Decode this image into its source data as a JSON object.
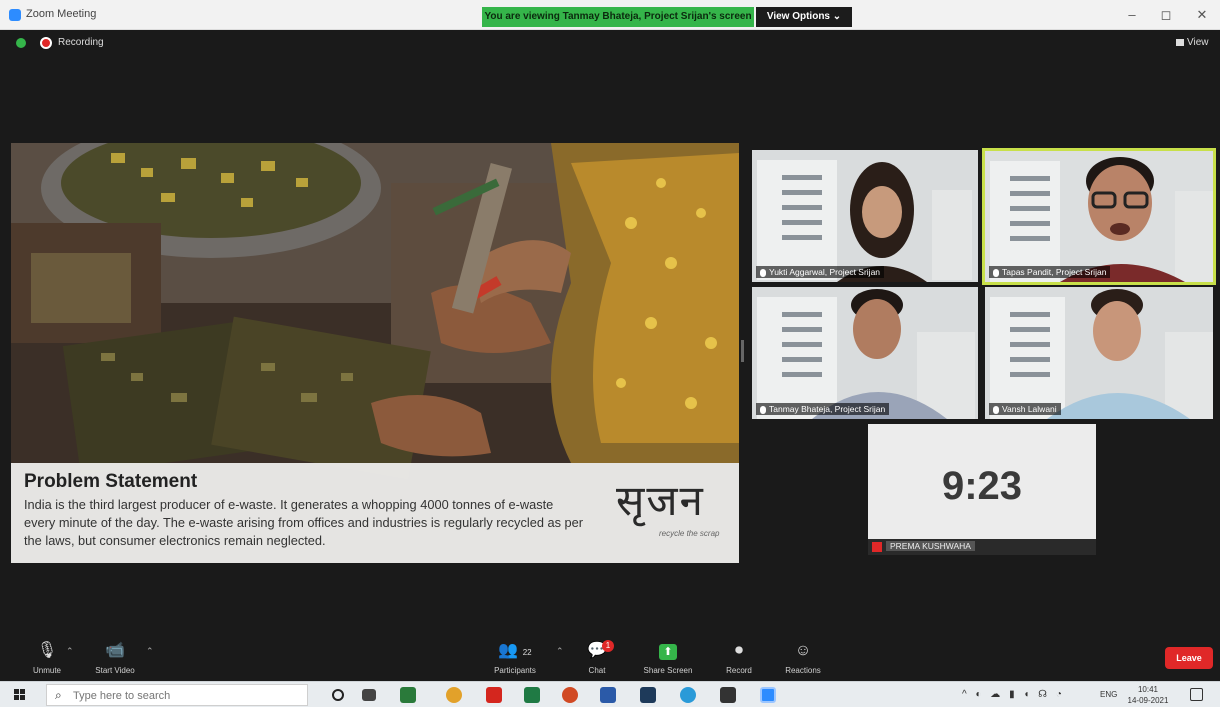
{
  "window": {
    "title": "Zoom Meeting",
    "share_banner": "You are viewing Tanmay Bhateja, Project Srijan's screen",
    "view_options": "View Options ⌄",
    "controls": [
      "–",
      "◻",
      "✕"
    ]
  },
  "meeting_bar": {
    "recording_label": "Recording",
    "view_label": "View"
  },
  "slide": {
    "title": "Problem Statement",
    "body": "India is the third largest producer of e-waste. It generates a whopping 4000 tonnes of e-waste every minute of the day. The e-waste arising from offices and industries is regularly recycled as per the laws, but consumer electronics remain neglected.",
    "logo_text": "सृजन",
    "logo_tagline": "recycle the scrap"
  },
  "participants": [
    {
      "name": "Yukti Aggarwal, Project Srijan",
      "active": false
    },
    {
      "name": "Tapas Pandit, Project Srijan",
      "active": true
    },
    {
      "name": "Tanmay Bhateja, Project Srijan",
      "active": false
    },
    {
      "name": "Vansh Lalwani",
      "active": false
    }
  ],
  "timer_tile": {
    "time": "9:23",
    "name": "PREMA KUSHWAHA"
  },
  "toolbar": {
    "unmute": "Unmute",
    "start_video": "Start Video",
    "participants": "Participants",
    "participants_count": "22",
    "chat": "Chat",
    "chat_badge": "1",
    "share_screen": "Share Screen",
    "record": "Record",
    "reactions": "Reactions",
    "leave": "Leave"
  },
  "taskbar": {
    "search_placeholder": "Type here to search",
    "language": "ENG",
    "time": "10:41",
    "date": "14-09-2021"
  },
  "colors": {
    "zoom_green": "#35b54a",
    "leave_red": "#e02828",
    "active_speaker": "#c8e04a"
  }
}
